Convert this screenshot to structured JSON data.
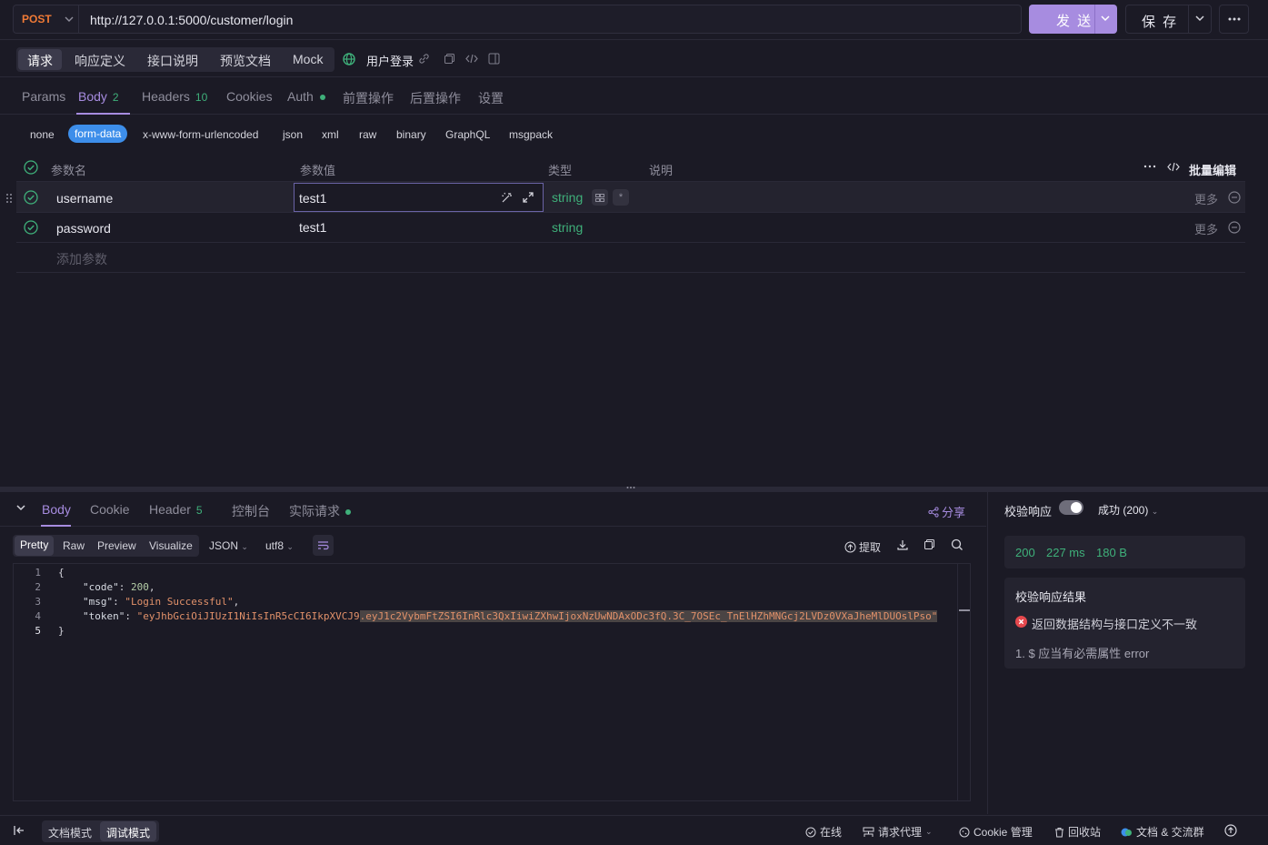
{
  "request": {
    "method": "POST",
    "url": "http://127.0.0.1:5000/customer/login",
    "send_label": "发 送",
    "save_label": "保 存"
  },
  "mode_tabs": [
    "请求",
    "响应定义",
    "接口说明",
    "预览文档",
    "Mock"
  ],
  "api_name": "用户登录",
  "req_tabs": {
    "params": "Params",
    "body": "Body",
    "body_count": "2",
    "headers": "Headers",
    "headers_count": "10",
    "cookies": "Cookies",
    "auth": "Auth",
    "pre": "前置操作",
    "post": "后置操作",
    "settings": "设置"
  },
  "body_types": [
    "none",
    "form-data",
    "x-www-form-urlencoded",
    "json",
    "xml",
    "raw",
    "binary",
    "GraphQL",
    "msgpack"
  ],
  "params_table": {
    "headers": {
      "name": "参数名",
      "value": "参数值",
      "type": "类型",
      "desc": "说明"
    },
    "bulk_edit": "批量编辑",
    "rows": [
      {
        "name": "username",
        "value": "test1",
        "type": "string",
        "more": "更多"
      },
      {
        "name": "password",
        "value": "test1",
        "type": "string",
        "more": "更多"
      }
    ],
    "add_placeholder": "添加参数"
  },
  "response_tabs": {
    "body": "Body",
    "cookie": "Cookie",
    "header": "Header",
    "header_count": "5",
    "console": "控制台",
    "actual": "实际请求",
    "share": "分享"
  },
  "view_modes": [
    "Pretty",
    "Raw",
    "Preview",
    "Visualize"
  ],
  "format": "JSON",
  "encoding": "utf8",
  "extract_label": "提取",
  "code_lines": {
    "l1": "{",
    "key_code": "\"code\"",
    "val_code": "200",
    "key_msg": "\"msg\"",
    "val_msg": "\"Login Successful\"",
    "key_token": "\"token\"",
    "val_token_a": "\"eyJhbGciOiJIUzI1NiIsInR5cCI6IkpXVCJ9",
    "val_token_b": ".eyJ1c2VybmFtZSI6InRlc3QxIiwiZXhwIjoxNzUwNDAxODc3fQ.3C_7OSEc_TnElHZhMNGcj2LVDz0VXaJheMlDUOslPso\"",
    "l5": "}"
  },
  "line_numbers": [
    "1",
    "2",
    "3",
    "4",
    "5"
  ],
  "validation": {
    "label": "校验响应",
    "status_select": "成功 (200)",
    "status_code": "200",
    "time": "227 ms",
    "size": "180 B",
    "result_title": "校验响应结果",
    "error_msg": "返回数据结构与接口定义不一致",
    "error_detail": "1. $ 应当有必需属性 error"
  },
  "footer": {
    "doc_mode": "文档模式",
    "debug_mode": "调试模式",
    "online": "在线",
    "proxy": "请求代理",
    "cookie": "Cookie 管理",
    "recycle": "回收站",
    "community": "文档 & 交流群"
  },
  "colors": {
    "accent": "#a78ce0",
    "method": "#f07a36",
    "success": "#3fb07a",
    "error": "#e5484d",
    "form_data": "#3d8eea"
  }
}
